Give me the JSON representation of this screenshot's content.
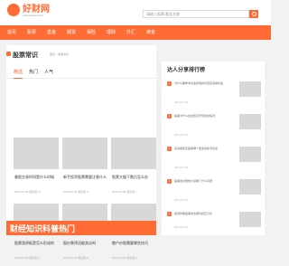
{
  "header": {
    "logo": "好财网",
    "logo_sub": "www.haocai.com",
    "search_placeholder": "请输入股票/基金名称"
  },
  "nav": [
    "首页",
    "股票",
    "基金",
    "期货",
    "保险",
    "理财",
    "外汇",
    "黄金"
  ],
  "main": {
    "section_title": "股票常识",
    "section_note": "首页 > 股票常识",
    "tabs": [
      "精选",
      "热门",
      "人气"
    ],
    "cards": [
      {
        "title": "美股交易时间是什么时候",
        "meta": "2024-02-06 阅读量 12"
      },
      {
        "title": "新手投资股票需要注意什么",
        "meta": "2024-02-06 阅读量 9"
      },
      {
        "title": "股票大幅下跌后怎么办",
        "meta": "2024-02-06 阅读量 7"
      },
      {
        "title": "股票涨停板是怎么形成的",
        "meta": "2024-02-06 阅读量 5"
      },
      {
        "title": "股价跌停还能卖出吗",
        "meta": "2024-02-06 阅读量 8"
      },
      {
        "title": "散户炒股需要哪些技巧",
        "meta": "2024-02-06 阅读量 6"
      }
    ],
    "banner": "财经知识科普热门"
  },
  "side": {
    "title": "达人分享排行榜",
    "items": [
      {
        "num": "1",
        "text": "为什么要参考基金费用的高低来选择基金",
        "date": "2024-02-06"
      },
      {
        "num": "2",
        "text": "股票为什么会出现高开低走的情况",
        "date": "2024-02-06"
      },
      {
        "num": "3",
        "text": "买基金和买股票哪个更适合新手投资",
        "date": "2024-02-06"
      },
      {
        "num": "4",
        "text": "股票成交量放大说明了什么问题",
        "date": "2024-02-06"
      },
      {
        "num": "5",
        "text": "如何判断股票的支撑位和压力位",
        "date": "2024-02-06"
      }
    ]
  },
  "colors": {
    "accent": "#ff6b35"
  }
}
